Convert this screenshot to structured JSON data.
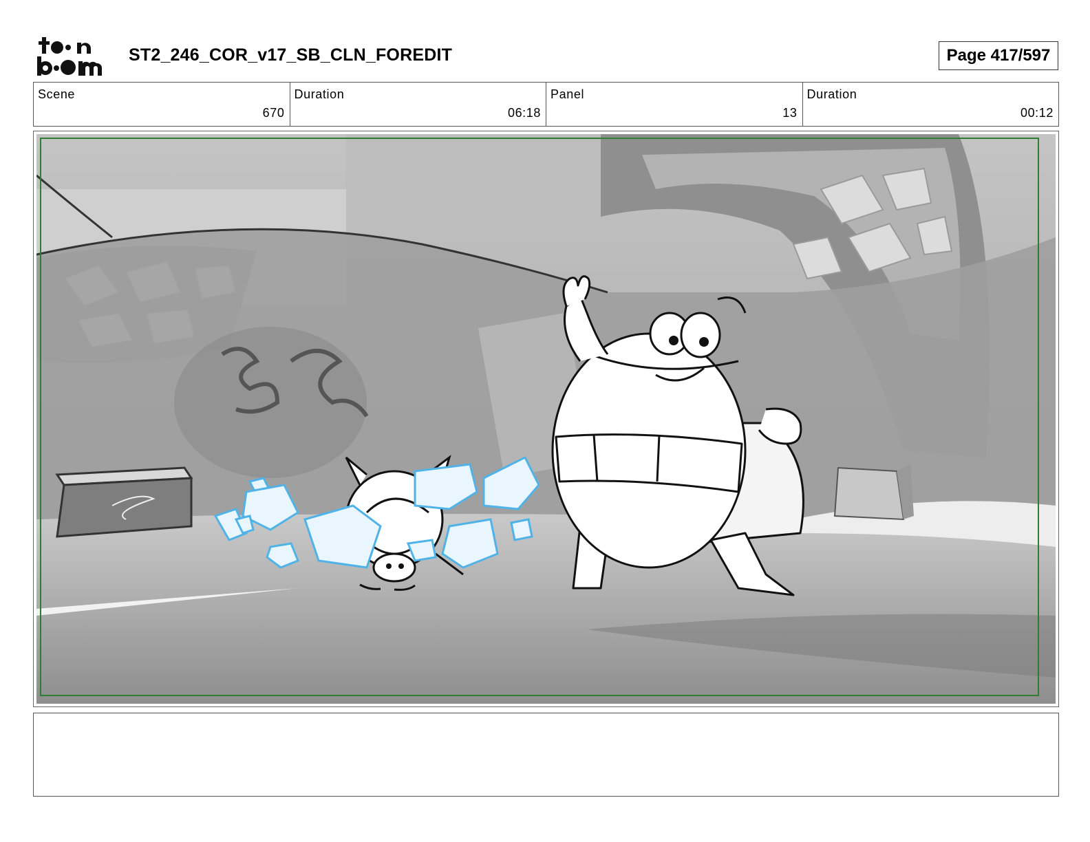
{
  "header": {
    "logo_text_top": "toon",
    "logo_text_bottom": "boom",
    "title": "ST2_246_COR_v17_SB_CLN_FOREDIT",
    "page_label": "Page 417/597"
  },
  "info": [
    {
      "label": "Scene",
      "value": "670"
    },
    {
      "label": "Duration",
      "value": "06:18"
    },
    {
      "label": "Panel",
      "value": "13"
    },
    {
      "label": "Duration",
      "value": "00:12"
    }
  ],
  "notes": {
    "text": ""
  },
  "colors": {
    "safe_frame": "#2e7d32",
    "ice_outline": "#4fb3e8",
    "sketch_line": "#111111"
  }
}
